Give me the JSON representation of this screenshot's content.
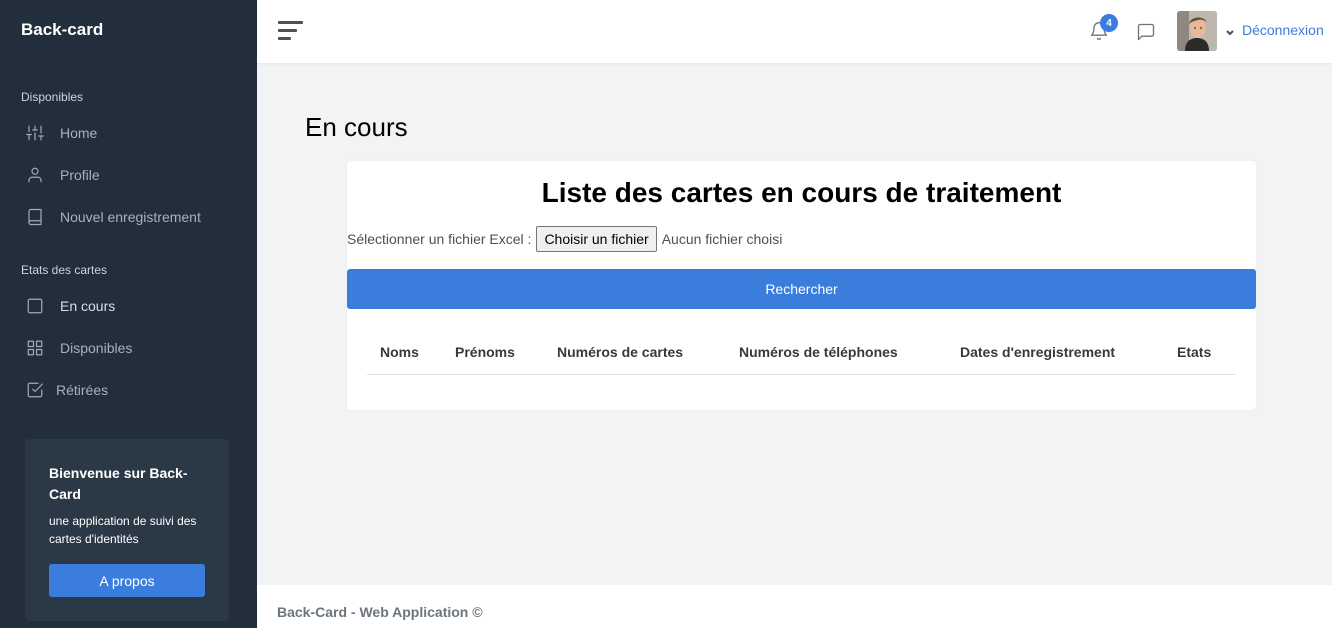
{
  "sidebar": {
    "brand": "Back-card",
    "sections": [
      {
        "header": "Disponibles",
        "items": [
          {
            "label": "Home",
            "icon": "sliders-icon"
          },
          {
            "label": "Profile",
            "icon": "user-icon"
          },
          {
            "label": "Nouvel enregistrement",
            "icon": "book-icon"
          }
        ]
      },
      {
        "header": "Etats des cartes",
        "items": [
          {
            "label": "En cours",
            "icon": "square-icon"
          },
          {
            "label": "Disponibles",
            "icon": "grid-icon"
          },
          {
            "label": "Rétirées",
            "icon": "check-square-icon"
          }
        ]
      }
    ],
    "promo": {
      "title": "Bienvenue sur Back-Card",
      "text": "une application de suivi des cartes d'identités",
      "button": "A propos"
    }
  },
  "topbar": {
    "notifications_count": "4",
    "logout_label": "Déconnexion"
  },
  "main": {
    "page_title": "En cours",
    "card": {
      "title": "Liste des cartes en cours de traitement",
      "file_label": "Sélectionner un fichier Excel :",
      "file_button": "Choisir un fichier",
      "file_status": "Aucun fichier choisi",
      "search_button": "Rechercher",
      "table_headers": [
        "Noms",
        "Prénoms",
        "Numéros de cartes",
        "Numéros de téléphones",
        "Dates d'enregistrement",
        "Etats"
      ]
    }
  },
  "footer": {
    "text": "Back-Card - Web Application ©"
  },
  "colors": {
    "sidebar_bg": "#222e3c",
    "accent": "#3b7ddd",
    "page_bg": "#f2f3f5"
  }
}
